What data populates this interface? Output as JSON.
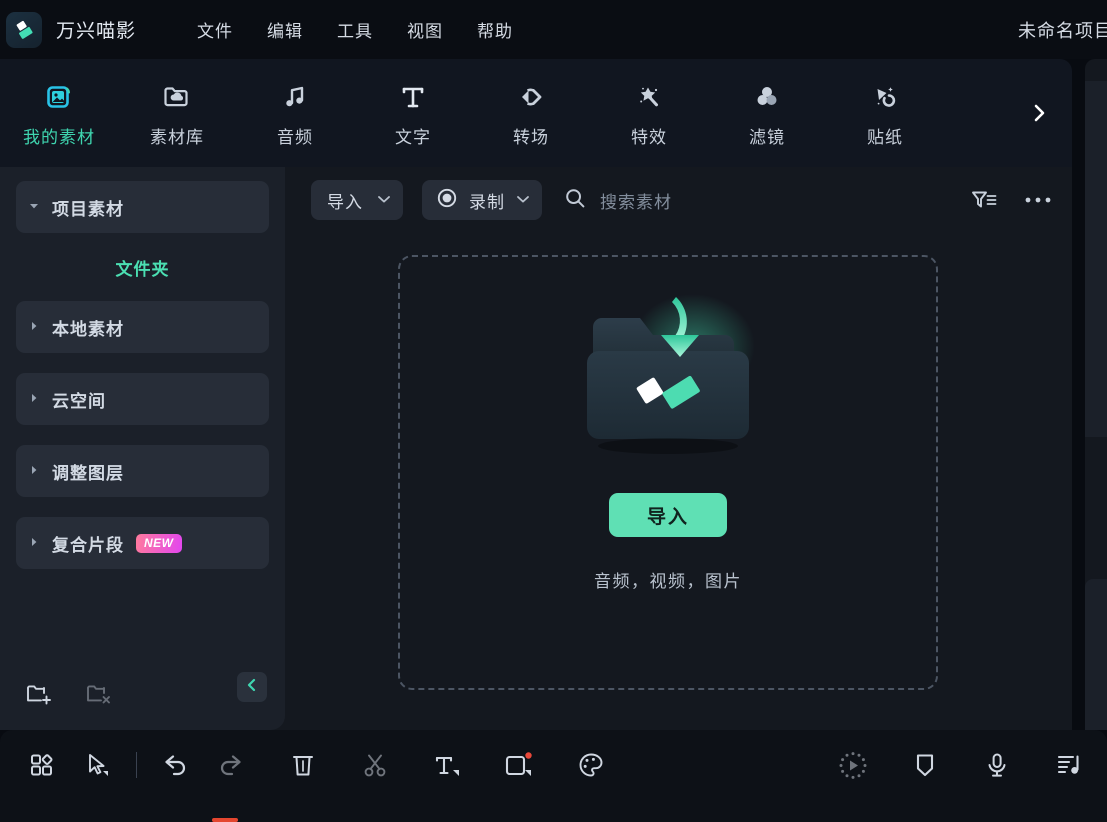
{
  "titlebar": {
    "logo_icon": "filmora-logo-icon",
    "app_name": "万兴喵影",
    "menus": [
      {
        "label": "文件"
      },
      {
        "label": "编辑"
      },
      {
        "label": "工具"
      },
      {
        "label": "视图"
      },
      {
        "label": "帮助"
      }
    ],
    "project_title": "未命名项目"
  },
  "tabs": [
    {
      "label": "我的素材",
      "icon": "media-image-icon",
      "active": true
    },
    {
      "label": "素材库",
      "icon": "folder-cloud-icon",
      "active": false
    },
    {
      "label": "音频",
      "icon": "music-note-icon",
      "active": false
    },
    {
      "label": "文字",
      "icon": "text-t-icon",
      "active": false
    },
    {
      "label": "转场",
      "icon": "transition-arrows-icon",
      "active": false
    },
    {
      "label": "特效",
      "icon": "magic-star-icon",
      "active": false
    },
    {
      "label": "滤镜",
      "icon": "filter-circles-icon",
      "active": false
    },
    {
      "label": "贴纸",
      "icon": "sticker-shapes-icon",
      "active": false
    }
  ],
  "tabs_more_icon": "chevron-right-icon",
  "sidebar": {
    "items": [
      {
        "label": "项目素材",
        "expanded": true,
        "caret": "caret-down-icon"
      },
      {
        "label": "文件夹",
        "highlight": true
      },
      {
        "label": "本地素材",
        "expanded": false,
        "caret": "caret-right-icon"
      },
      {
        "label": "云空间",
        "expanded": false,
        "caret": "caret-right-icon"
      },
      {
        "label": "调整图层",
        "expanded": false,
        "caret": "caret-right-icon"
      },
      {
        "label": "复合片段",
        "expanded": false,
        "caret": "caret-right-icon",
        "badge": "NEW"
      }
    ],
    "footer": {
      "new_folder_icon": "folder-add-icon",
      "delete_folder_icon": "folder-delete-icon",
      "collapse_icon": "chevron-left-icon"
    }
  },
  "content_toolbar": {
    "import_label": "导入",
    "import_caret_icon": "chevron-down-icon",
    "record_label": "录制",
    "record_icon": "record-circle-icon",
    "record_caret_icon": "chevron-down-icon",
    "search_icon": "search-icon",
    "search_placeholder": "搜索素材",
    "filter_icon": "filter-sort-icon",
    "more_icon": "more-dots-icon"
  },
  "dropzone": {
    "art_icon": "folder-import-arrow-icon",
    "import_button": "导入",
    "caption": "音频，视频，图片"
  },
  "bottom_toolbar": {
    "left_icons": [
      {
        "name": "layout-grid-icon",
        "dim": false
      },
      {
        "name": "select-cursor-icon",
        "dim": false
      },
      {
        "name": "divider",
        "dim": false
      },
      {
        "name": "undo-icon",
        "dim": false
      },
      {
        "name": "redo-icon",
        "dim": true
      },
      {
        "name": "delete-trash-icon",
        "dim": false
      },
      {
        "name": "split-scissors-icon",
        "dim": true
      },
      {
        "name": "text-tool-icon",
        "dim": false
      },
      {
        "name": "crop-shape-icon",
        "dim": false,
        "badge_dot": true
      },
      {
        "name": "color-palette-icon",
        "dim": false
      }
    ],
    "right_icons": [
      {
        "name": "render-preview-icon",
        "dim": true
      },
      {
        "name": "marker-icon",
        "dim": false
      },
      {
        "name": "voiceover-mic-icon",
        "dim": false
      },
      {
        "name": "audio-mixer-icon",
        "dim": false
      }
    ]
  },
  "colors": {
    "accent": "#3fd6b0",
    "accent_button": "#5fe0b4",
    "badge_new_start": "#ff7a9c",
    "badge_new_end": "#e246f0",
    "playhead": "#e4462f",
    "panel_bg": "#14181f",
    "sidebar_bg": "#1b2029",
    "titlebar_bg": "#0a0d13"
  }
}
